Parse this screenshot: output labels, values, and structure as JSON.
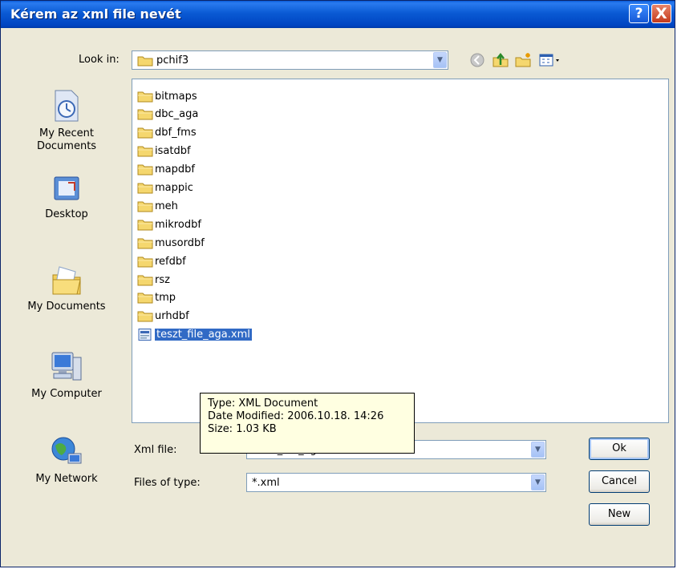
{
  "window": {
    "title": "Kérem az xml file nevét",
    "help_label": "?",
    "close_label": "X"
  },
  "lookin": {
    "label": "Look in:",
    "value": "pchif3"
  },
  "places": [
    {
      "label_line1": "My Recent",
      "label_line2": "Documents"
    },
    {
      "label_line1": "Desktop",
      "label_line2": ""
    },
    {
      "label_line1": "My Documents",
      "label_line2": ""
    },
    {
      "label_line1": "My Computer",
      "label_line2": ""
    },
    {
      "label_line1": "My Network",
      "label_line2": ""
    }
  ],
  "files": [
    {
      "name": "bitmaps",
      "type": "folder"
    },
    {
      "name": "dbc_aga",
      "type": "folder"
    },
    {
      "name": "dbf_fms",
      "type": "folder"
    },
    {
      "name": "isatdbf",
      "type": "folder"
    },
    {
      "name": "mapdbf",
      "type": "folder"
    },
    {
      "name": "mappic",
      "type": "folder"
    },
    {
      "name": "meh",
      "type": "folder"
    },
    {
      "name": "mikrodbf",
      "type": "folder"
    },
    {
      "name": "musordbf",
      "type": "folder"
    },
    {
      "name": "refdbf",
      "type": "folder"
    },
    {
      "name": "rsz",
      "type": "folder"
    },
    {
      "name": "tmp",
      "type": "folder"
    },
    {
      "name": "urhdbf",
      "type": "folder"
    },
    {
      "name": "teszt_file_aga.xml",
      "type": "xml",
      "selected": true
    }
  ],
  "tooltip": {
    "type_line": "Type: XML Document",
    "date_line": "Date Modified: 2006.10.18. 14:26",
    "size_line": "Size: 1.03 KB"
  },
  "filename": {
    "label": "Xml file:",
    "value": "teszt_file_aga.xml"
  },
  "filetype": {
    "label": "Files of type:",
    "value": "*.xml"
  },
  "buttons": {
    "ok": "Ok",
    "cancel": "Cancel",
    "new": "New"
  }
}
